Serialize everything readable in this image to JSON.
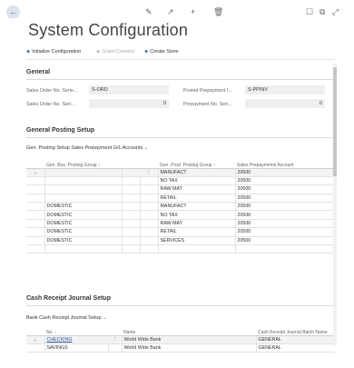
{
  "window": {
    "back_icon": "back-arrow-icon"
  },
  "toolbar_icons": [
    "edit-pencil-icon",
    "share-icon",
    "new-plus-icon",
    "delete-trash-icon",
    "bookmark-icon",
    "open-new-window-icon",
    "collapse-icon"
  ],
  "page_title": "System Configuration",
  "actions": {
    "initialize": "Initialize Configuration",
    "grant_consent": "Grant Consent",
    "create_store": "Create Store"
  },
  "general": {
    "title": "General",
    "sales_order_series_label": "Sales Order No. Serie...",
    "sales_order_series_value": "S-ORD",
    "sales_order_seri_label": "Sales Order No. Seri...",
    "sales_order_seri_value": "0",
    "posted_prepayment_label": "Posted Prepayment I...",
    "posted_prepayment_value": "S-PPINV",
    "prepayment_seri_label": "Prepayment No. Seri...",
    "prepayment_seri_value": "0"
  },
  "posting": {
    "title": "General Posting Setup",
    "subpart_label": "Gen. Posting Setup Sales Prepayment G/L Accounts",
    "columns": [
      "Gen. Bus. Posting Group ↑",
      "Gen. Prod. Posting Group ↑",
      "Sales Prepayments Account"
    ],
    "rows": [
      {
        "bus": "",
        "prod": "MANUFACT",
        "acct": "20500"
      },
      {
        "bus": "",
        "prod": "NO TAX",
        "acct": "20500"
      },
      {
        "bus": "",
        "prod": "RAW MAT",
        "acct": "20500"
      },
      {
        "bus": "",
        "prod": "RETAIL",
        "acct": "20500"
      },
      {
        "bus": "DOMESTIC",
        "prod": "MANUFACT",
        "acct": "20500"
      },
      {
        "bus": "DOMESTIC",
        "prod": "NO TAX",
        "acct": "20500"
      },
      {
        "bus": "DOMESTIC",
        "prod": "RAW MAT",
        "acct": "20500"
      },
      {
        "bus": "DOMESTIC",
        "prod": "RETAIL",
        "acct": "20500"
      },
      {
        "bus": "DOMESTIC",
        "prod": "SERVICES",
        "acct": "20500"
      },
      {
        "bus": "",
        "prod": "",
        "acct": ""
      }
    ]
  },
  "cash": {
    "title": "Cash Receipt Journal Setup",
    "subpart_label": "Bank Cash Receipt Journal Setup",
    "columns": [
      "No. ↑",
      "Name",
      "Cash Receipt Journal Batch Name"
    ],
    "rows": [
      {
        "no": "CHECKING",
        "name": "World Wide Bank",
        "batch": "GENERAL"
      },
      {
        "no": "SAVINGS",
        "name": "World Wide Bank",
        "batch": "GENERAL"
      }
    ]
  }
}
